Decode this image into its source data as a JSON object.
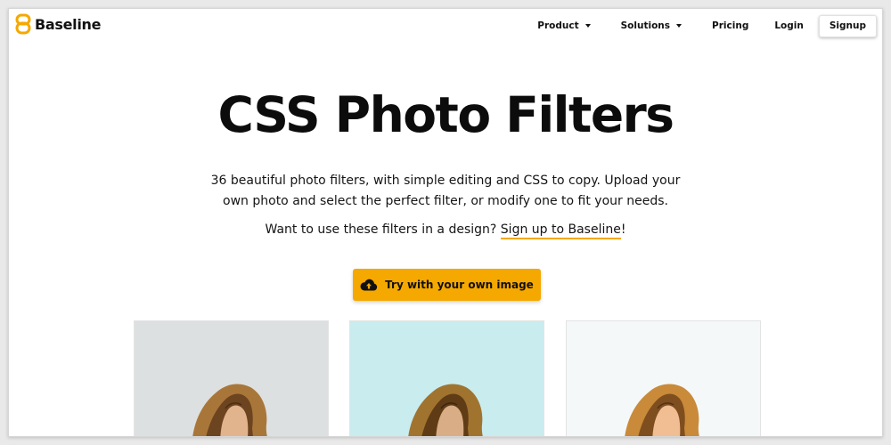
{
  "colors": {
    "accent": "#f5a800",
    "text": "#111111",
    "page_background": "#ffffff"
  },
  "header": {
    "logo_icon": "baseline-logo-icon",
    "brand": "Baseline",
    "nav": {
      "product": "Product",
      "solutions": "Solutions",
      "pricing": "Pricing",
      "login": "Login",
      "signup": "Signup"
    }
  },
  "hero": {
    "title": "CSS Photo Filters",
    "description_line_1": "36 beautiful photo filters, with simple editing and CSS to copy. Upload your",
    "description_line_2": "own photo and select the perfect filter, or modify one to fit your needs.",
    "cta_prefix": "Want to use these filters in a design? ",
    "cta_link": "Sign up to Baseline",
    "cta_suffix": "!",
    "upload_button": "Try with your own image",
    "upload_icon": "cloud-upload-icon"
  },
  "filter_previews": [
    {
      "icon": "photo-thumbnail",
      "tint": "#dde0e0"
    },
    {
      "icon": "photo-thumbnail",
      "tint": "#c9ecef"
    },
    {
      "icon": "photo-thumbnail",
      "tint": "#f4f8f8"
    }
  ]
}
